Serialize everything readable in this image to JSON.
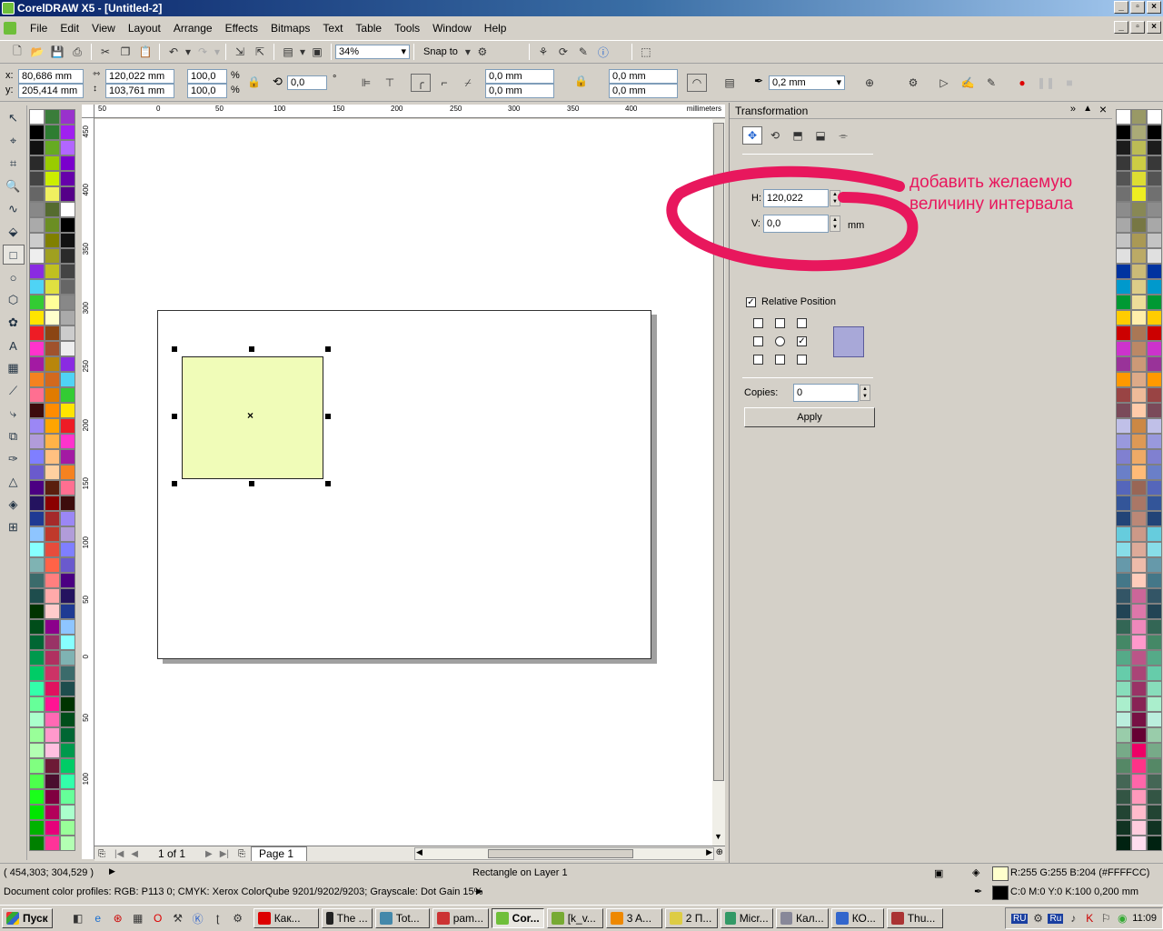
{
  "window": {
    "title": "CorelDRAW X5 - [Untitled-2]",
    "minimize": "_",
    "restore": "▫",
    "close": "×"
  },
  "menu": [
    "File",
    "Edit",
    "View",
    "Layout",
    "Arrange",
    "Effects",
    "Bitmaps",
    "Text",
    "Table",
    "Tools",
    "Window",
    "Help"
  ],
  "standard_toolbar": {
    "zoom": "34%",
    "snap_to": "Snap to"
  },
  "property_bar": {
    "x": "80,686 mm",
    "y": "205,414 mm",
    "w": "120,022 mm",
    "h": "103,761 mm",
    "scale_x": "100,0",
    "scale_y": "100,0",
    "pct": "%",
    "angle": "0,0",
    "deg": "°",
    "corner1": "0,0 mm",
    "corner2": "0,0 mm",
    "corner3": "0,0 mm",
    "corner4": "0,0 mm",
    "outline": "0,2 mm",
    "x_lbl": "x:",
    "y_lbl": "y:"
  },
  "ruler": {
    "unit": "millimeters",
    "h_ticks": [
      "50",
      "0",
      "50",
      "100",
      "150",
      "200",
      "250",
      "300",
      "350",
      "400"
    ],
    "v_ticks": [
      "450",
      "400",
      "350",
      "300",
      "250",
      "200",
      "150",
      "100",
      "50",
      "0",
      "50",
      "100"
    ]
  },
  "page_nav": {
    "counter": "1 of 1",
    "page_tab": "Page 1"
  },
  "docker": {
    "title": "Transformation",
    "h_label": "H:",
    "h_value": "120,022",
    "v_label": "V:",
    "v_value": "0,0",
    "unit": "mm",
    "relative_position": "Relative Position",
    "copies_label": "Copies:",
    "copies_value": "0",
    "apply": "Apply"
  },
  "annotation": {
    "line1": "добавить желаемую",
    "line2": "величину интервала",
    "color": "#e8175d"
  },
  "status": {
    "coords": "( 454,303; 304,529 )",
    "object": "Rectangle on Layer 1",
    "fill": "R:255 G:255 B:204 (#FFFFCC)",
    "outline": "C:0 M:0 Y:0 K:100  0,200 mm",
    "profiles": "Document color profiles: RGB: P113 0; CMYK: Xerox ColorQube 9201/9202/9203; Grayscale: Dot Gain 15%"
  },
  "taskbar": {
    "start": "Пуск",
    "clock": "11:09",
    "tasks": [
      "Как...",
      "The ...",
      "Tot...",
      "pam...",
      "Cor...",
      "[k_v...",
      "3 A...",
      "2 П...",
      "Micr...",
      "Кал...",
      "КО...",
      "Thu..."
    ],
    "lang": [
      "RU",
      "Ru"
    ]
  },
  "colors": {
    "rect_fill": "#f0fcb8",
    "accent": "#e8175d"
  }
}
